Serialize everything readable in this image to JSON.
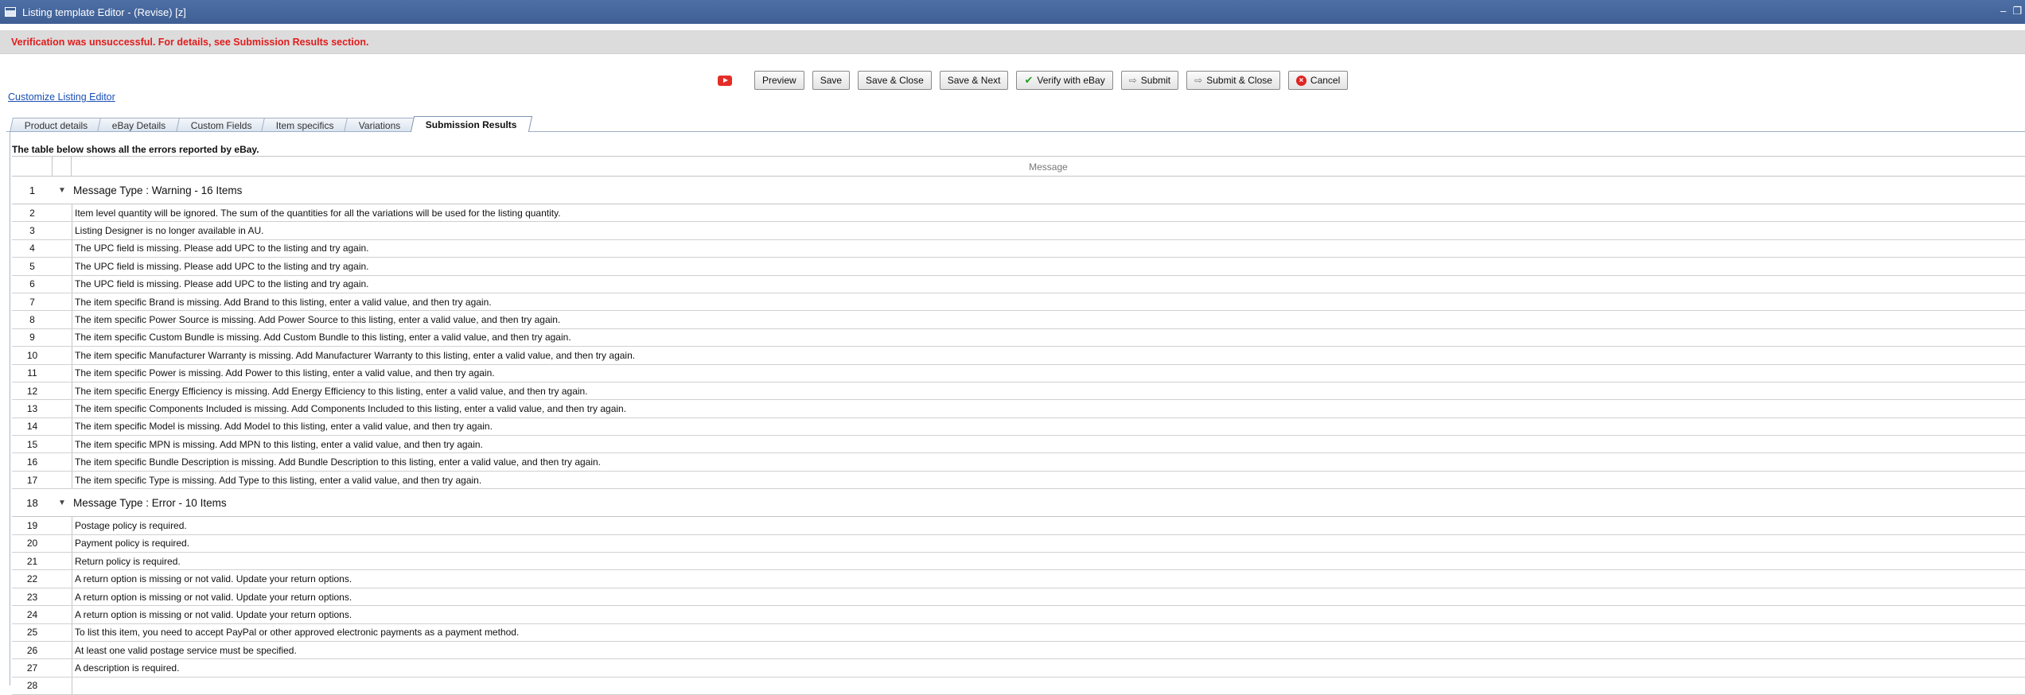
{
  "window": {
    "title": "Listing template Editor - (Revise) [z]"
  },
  "banner": {
    "message": "Verification was unsuccessful. For details, see Submission Results section."
  },
  "toolbar": {
    "preview": "Preview",
    "save": "Save",
    "save_close": "Save & Close",
    "save_next": "Save & Next",
    "verify": "Verify with eBay",
    "submit": "Submit",
    "submit_close": "Submit & Close",
    "cancel": "Cancel"
  },
  "customize_link": "Customize Listing Editor",
  "tabs": [
    {
      "label": "Product details"
    },
    {
      "label": "eBay Details"
    },
    {
      "label": "Custom Fields"
    },
    {
      "label": "Item specifics"
    },
    {
      "label": "Variations"
    },
    {
      "label": "Submission Results"
    }
  ],
  "results": {
    "intro": "The table below shows all the errors reported by eBay.",
    "column_header": "Message",
    "groups": [
      {
        "num": "1",
        "title": "Message Type : Warning - 16 Items",
        "rows": [
          {
            "num": "2",
            "text": "Item level quantity will be ignored. The sum of the quantities for all the variations will be used for the listing quantity."
          },
          {
            "num": "3",
            "text": "Listing Designer is no longer available in AU."
          },
          {
            "num": "4",
            "text": "The UPC field is missing. Please add UPC to the listing and try again."
          },
          {
            "num": "5",
            "text": "The UPC field is missing. Please add UPC to the listing and try again."
          },
          {
            "num": "6",
            "text": "The UPC field is missing. Please add UPC to the listing and try again."
          },
          {
            "num": "7",
            "text": "The item specific Brand is missing. Add Brand to this listing, enter a valid value, and then try again."
          },
          {
            "num": "8",
            "text": "The item specific Power Source is missing. Add Power Source to this listing, enter a valid value, and then try again."
          },
          {
            "num": "9",
            "text": "The item specific Custom Bundle is missing. Add Custom Bundle to this listing, enter a valid value, and then try again."
          },
          {
            "num": "10",
            "text": "The item specific Manufacturer Warranty is missing. Add Manufacturer Warranty to this listing, enter a valid value, and then try again."
          },
          {
            "num": "11",
            "text": "The item specific Power is missing. Add Power to this listing, enter a valid value, and then try again."
          },
          {
            "num": "12",
            "text": "The item specific Energy Efficiency is missing. Add Energy Efficiency to this listing, enter a valid value, and then try again."
          },
          {
            "num": "13",
            "text": "The item specific Components Included is missing. Add Components Included to this listing, enter a valid value, and then try again."
          },
          {
            "num": "14",
            "text": "The item specific Model is missing. Add Model to this listing, enter a valid value, and then try again."
          },
          {
            "num": "15",
            "text": "The item specific MPN is missing. Add MPN to this listing, enter a valid value, and then try again."
          },
          {
            "num": "16",
            "text": "The item specific Bundle Description is missing. Add Bundle Description to this listing, enter a valid value, and then try again."
          },
          {
            "num": "17",
            "text": "The item specific Type is missing. Add Type to this listing, enter a valid value, and then try again."
          }
        ]
      },
      {
        "num": "18",
        "title": "Message Type : Error - 10 Items",
        "rows": [
          {
            "num": "19",
            "text": "Postage policy is required."
          },
          {
            "num": "20",
            "text": "Payment policy is required."
          },
          {
            "num": "21",
            "text": "Return policy is required."
          },
          {
            "num": "22",
            "text": "A return option is missing or not valid. Update your return options."
          },
          {
            "num": "23",
            "text": "A return option is missing or not valid. Update your return options."
          },
          {
            "num": "24",
            "text": "A return option is missing or not valid. Update your return options."
          },
          {
            "num": "25",
            "text": "To list this item, you need to accept PayPal or other approved electronic payments as a payment method."
          },
          {
            "num": "26",
            "text": "At least one valid postage service must be specified."
          },
          {
            "num": "27",
            "text": "A description is required."
          },
          {
            "num": "28",
            "text": ""
          }
        ]
      }
    ]
  }
}
